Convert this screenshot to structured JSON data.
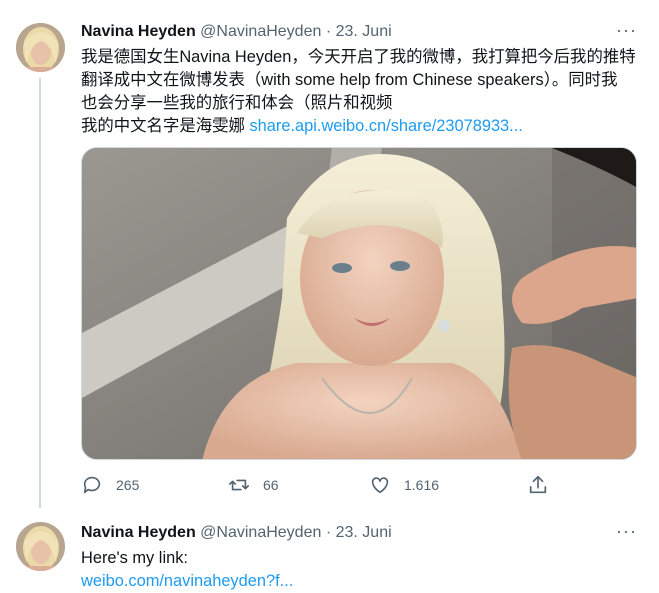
{
  "tweet1": {
    "name": "Navina Heyden",
    "handle": "@NavinaHeyden",
    "separator": "·",
    "date": "23. Juni",
    "more": "···",
    "line1": "我是德国女生Navina Heyden，今天开启了我的微博，我打算把今后我的推特",
    "line2": "翻译成中文在微博发表（with some help from Chinese speakers）。同时我",
    "line3": "也会分享一些我的旅行和体会（照片和视频",
    "line4_text": "我的中文名字是海雯娜 ",
    "line4_link": "share.api.weibo.cn/share/23078933...",
    "media_icon": "photo-woman-blonde-hair",
    "actions": {
      "reply_count": "265",
      "retweet_count": "66",
      "like_count": "1.616"
    }
  },
  "tweet2": {
    "name": "Navina Heyden",
    "handle": "@NavinaHeyden",
    "separator": "·",
    "date": "23. Juni",
    "more": "···",
    "line1": "Here's my link:",
    "link": "weibo.com/navinaheyden?f..."
  },
  "colors": {
    "link": "#1d9bf0",
    "secondary_text": "#536471",
    "thread_line": "#cfd9de"
  }
}
